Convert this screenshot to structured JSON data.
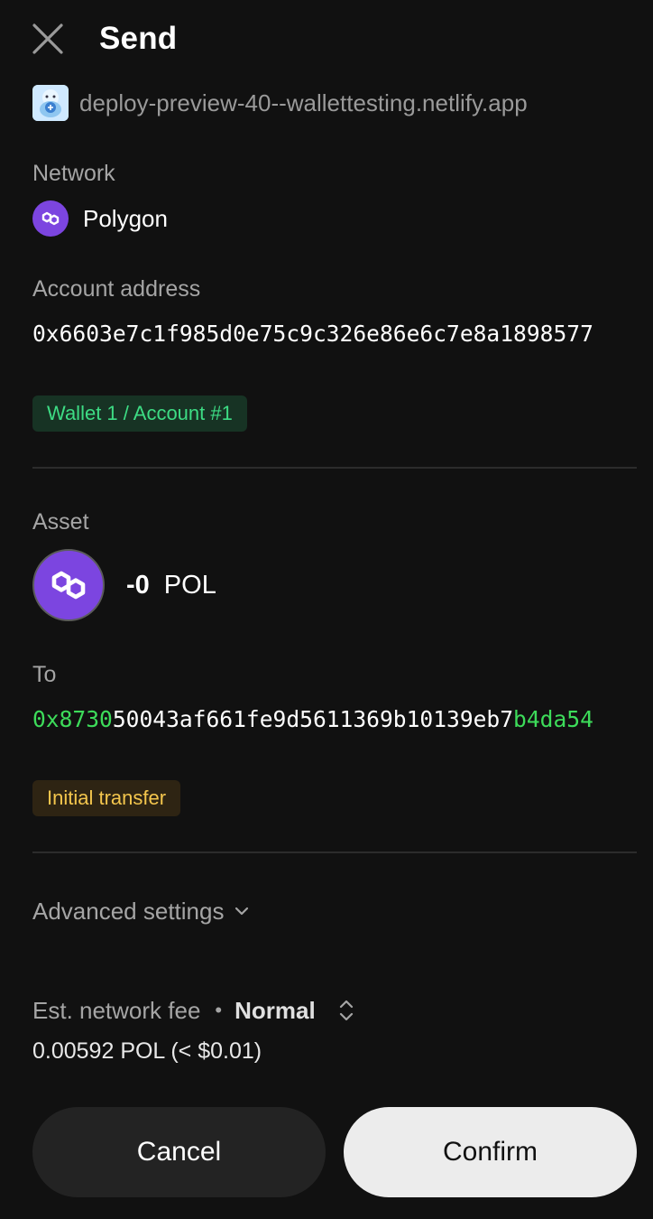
{
  "header": {
    "title": "Send"
  },
  "origin": {
    "url": "deploy-preview-40--wallettesting.netlify.app"
  },
  "network": {
    "label": "Network",
    "name": "Polygon"
  },
  "account": {
    "label": "Account address",
    "address": "0x6603e7c1f985d0e75c9c326e86e6c7e8a1898577",
    "badge": "Wallet 1 / Account #1"
  },
  "asset": {
    "label": "Asset",
    "amount": "-0",
    "symbol": "POL"
  },
  "recipient": {
    "label": "To",
    "address_prefix": "0x8730",
    "address_middle": "50043af661fe9d5611369b10139eb7",
    "address_suffix": "b4da54",
    "badge": "Initial transfer"
  },
  "advanced": {
    "label": "Advanced settings"
  },
  "fee": {
    "label": "Est. network fee",
    "separator": "•",
    "speed": "Normal",
    "value": "0.00592 POL (< $0.01)"
  },
  "buttons": {
    "cancel": "Cancel",
    "confirm": "Confirm"
  },
  "colors": {
    "background": "#111111",
    "polygon_purple": "#7c45e0",
    "highlight_green": "#3ddc5a",
    "badge_green_text": "#3ddc84",
    "badge_yellow_text": "#f4c64d"
  },
  "icons": {
    "close": "close-icon",
    "origin": "site-favicon-icon",
    "network": "polygon-icon",
    "asset": "pol-token-icon",
    "advanced": "chevron-down-icon",
    "fee_speed": "sort-updown-icon"
  }
}
